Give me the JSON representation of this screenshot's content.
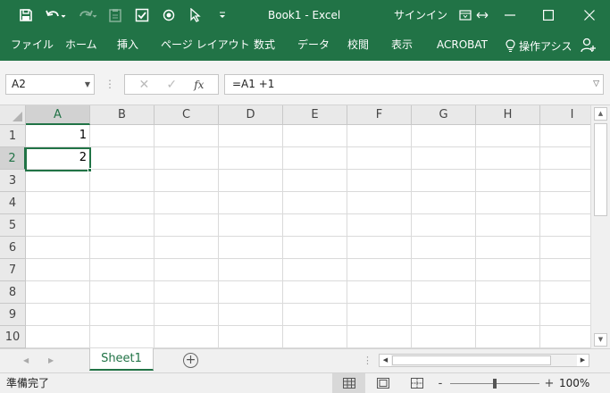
{
  "app": {
    "title": "Book1 - Excel",
    "signin": "サインイン",
    "accent": "#217346"
  },
  "quick_access": [
    {
      "name": "save-icon",
      "enabled": true
    },
    {
      "name": "undo-icon",
      "enabled": true
    },
    {
      "name": "redo-icon",
      "enabled": false
    },
    {
      "name": "clipboard-icon",
      "enabled": false
    },
    {
      "name": "checkbox-icon",
      "enabled": true
    },
    {
      "name": "radio-button-icon",
      "enabled": true
    },
    {
      "name": "pointer-icon",
      "enabled": true
    },
    {
      "name": "customize-dropdown-icon",
      "enabled": true
    }
  ],
  "ribbon": {
    "tabs": [
      "ファイル",
      "ホーム",
      "挿入",
      "ページ レイアウト",
      "数式",
      "データ",
      "校閲",
      "表示",
      "ACROBAT"
    ],
    "tell_me": "操作アシス",
    "tell_me_icon": "lightbulb-icon",
    "share_icon": "person-add-icon"
  },
  "formula_bar": {
    "name_box": "A2",
    "formula": "=A1 +1",
    "cancel_glyph": "✕",
    "enter_glyph": "✓",
    "fx_label": "fx"
  },
  "grid": {
    "columns": [
      "A",
      "B",
      "C",
      "D",
      "E",
      "F",
      "G",
      "H",
      "I"
    ],
    "rows": [
      "1",
      "2",
      "3",
      "4",
      "5",
      "6",
      "7",
      "8",
      "9",
      "10"
    ],
    "selected_column": "A",
    "selected_row": "2",
    "active_cell": "A2",
    "cells": {
      "A1": "1",
      "A2": "2"
    }
  },
  "sheets": {
    "tabs": [
      "Sheet1"
    ],
    "active": "Sheet1",
    "add_label": "+"
  },
  "status_bar": {
    "ready": "準備完了",
    "view_buttons": [
      "normal-view-icon",
      "page-layout-view-icon",
      "page-break-view-icon"
    ],
    "active_view": "normal-view-icon",
    "zoom_minus": "-",
    "zoom_plus": "+",
    "zoom": "100%",
    "zoom_value": 100
  }
}
